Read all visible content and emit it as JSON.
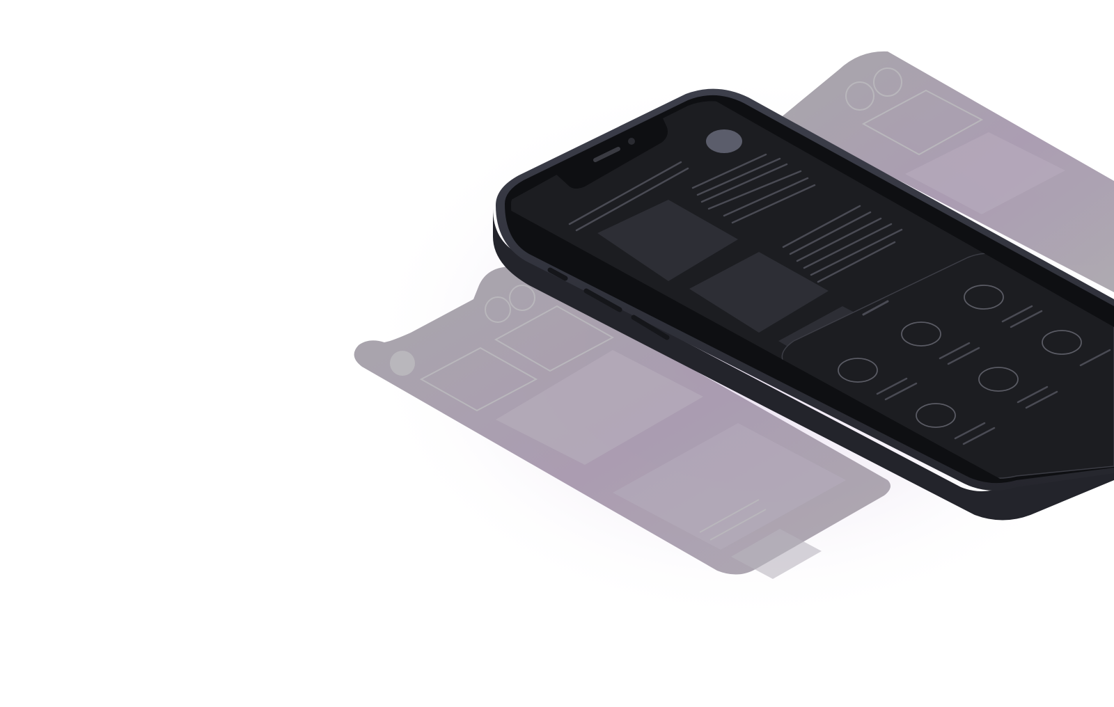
{
  "illustration": {
    "subject": "isometric-phone-mockup-with-wireframe-screens",
    "colors": {
      "background": "#ffffff",
      "glow": "#eadff2",
      "phone_body": "#2b2c34",
      "phone_edge": "#3b3d48",
      "bezel": "#0e0f12",
      "screen": "#1c1d21",
      "card": "#2d2e35",
      "wire_line": "#4a4b54",
      "avatar": "#5b5d6b",
      "ghost_screen": "#a3a1a6",
      "ghost_tint": "#a795ad",
      "ghost_outline": "#b6b4b9"
    }
  }
}
